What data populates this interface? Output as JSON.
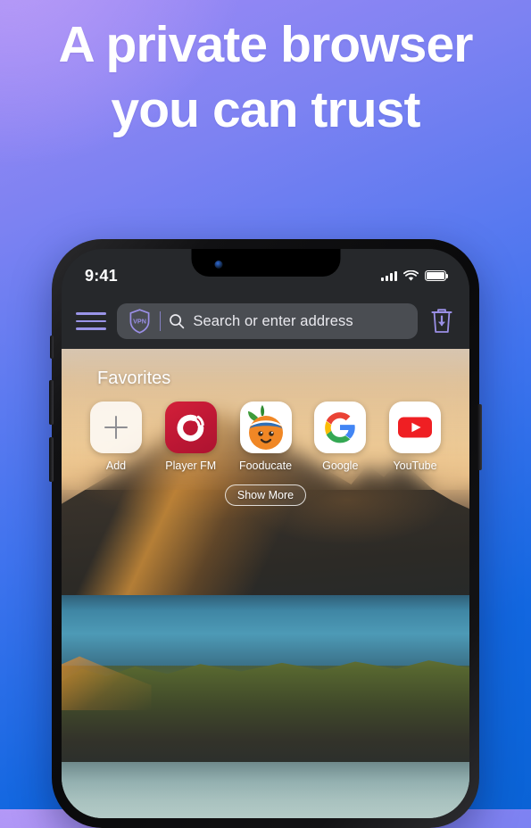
{
  "promo": {
    "headline_line1": "A private browser",
    "headline_line2": "you can trust",
    "bg_gradient_from": "#a78bfa",
    "bg_gradient_to": "#0a63d6"
  },
  "phone": {
    "status_bar": {
      "time": "9:41",
      "cellular_icon": "signal-bars-icon",
      "wifi_icon": "wifi-icon",
      "battery_icon": "battery-full-icon"
    },
    "toolbar": {
      "menu_icon": "hamburger-menu-icon",
      "vpn_badge_label": "VPN",
      "vpn_badge_icon": "shield-icon",
      "search_icon": "search-icon",
      "address_placeholder": "Search or enter address",
      "address_value": "",
      "clear_data_icon": "trash-download-icon",
      "accent_color": "#9a94e8"
    },
    "home": {
      "favorites_title": "Favorites",
      "show_more_label": "Show More",
      "tiles": [
        {
          "label": "Add",
          "icon": "plus-icon",
          "tile_color": "#ffffff"
        },
        {
          "label": "Player FM",
          "icon": "player-fm-icon",
          "tile_color": "#c4182f"
        },
        {
          "label": "Fooducate",
          "icon": "fooducate-icon",
          "tile_color": "#ffffff"
        },
        {
          "label": "Google",
          "icon": "google-g-icon",
          "tile_color": "#ffffff"
        },
        {
          "label": "YouTube",
          "icon": "youtube-icon",
          "tile_color": "#ffffff"
        }
      ]
    }
  }
}
